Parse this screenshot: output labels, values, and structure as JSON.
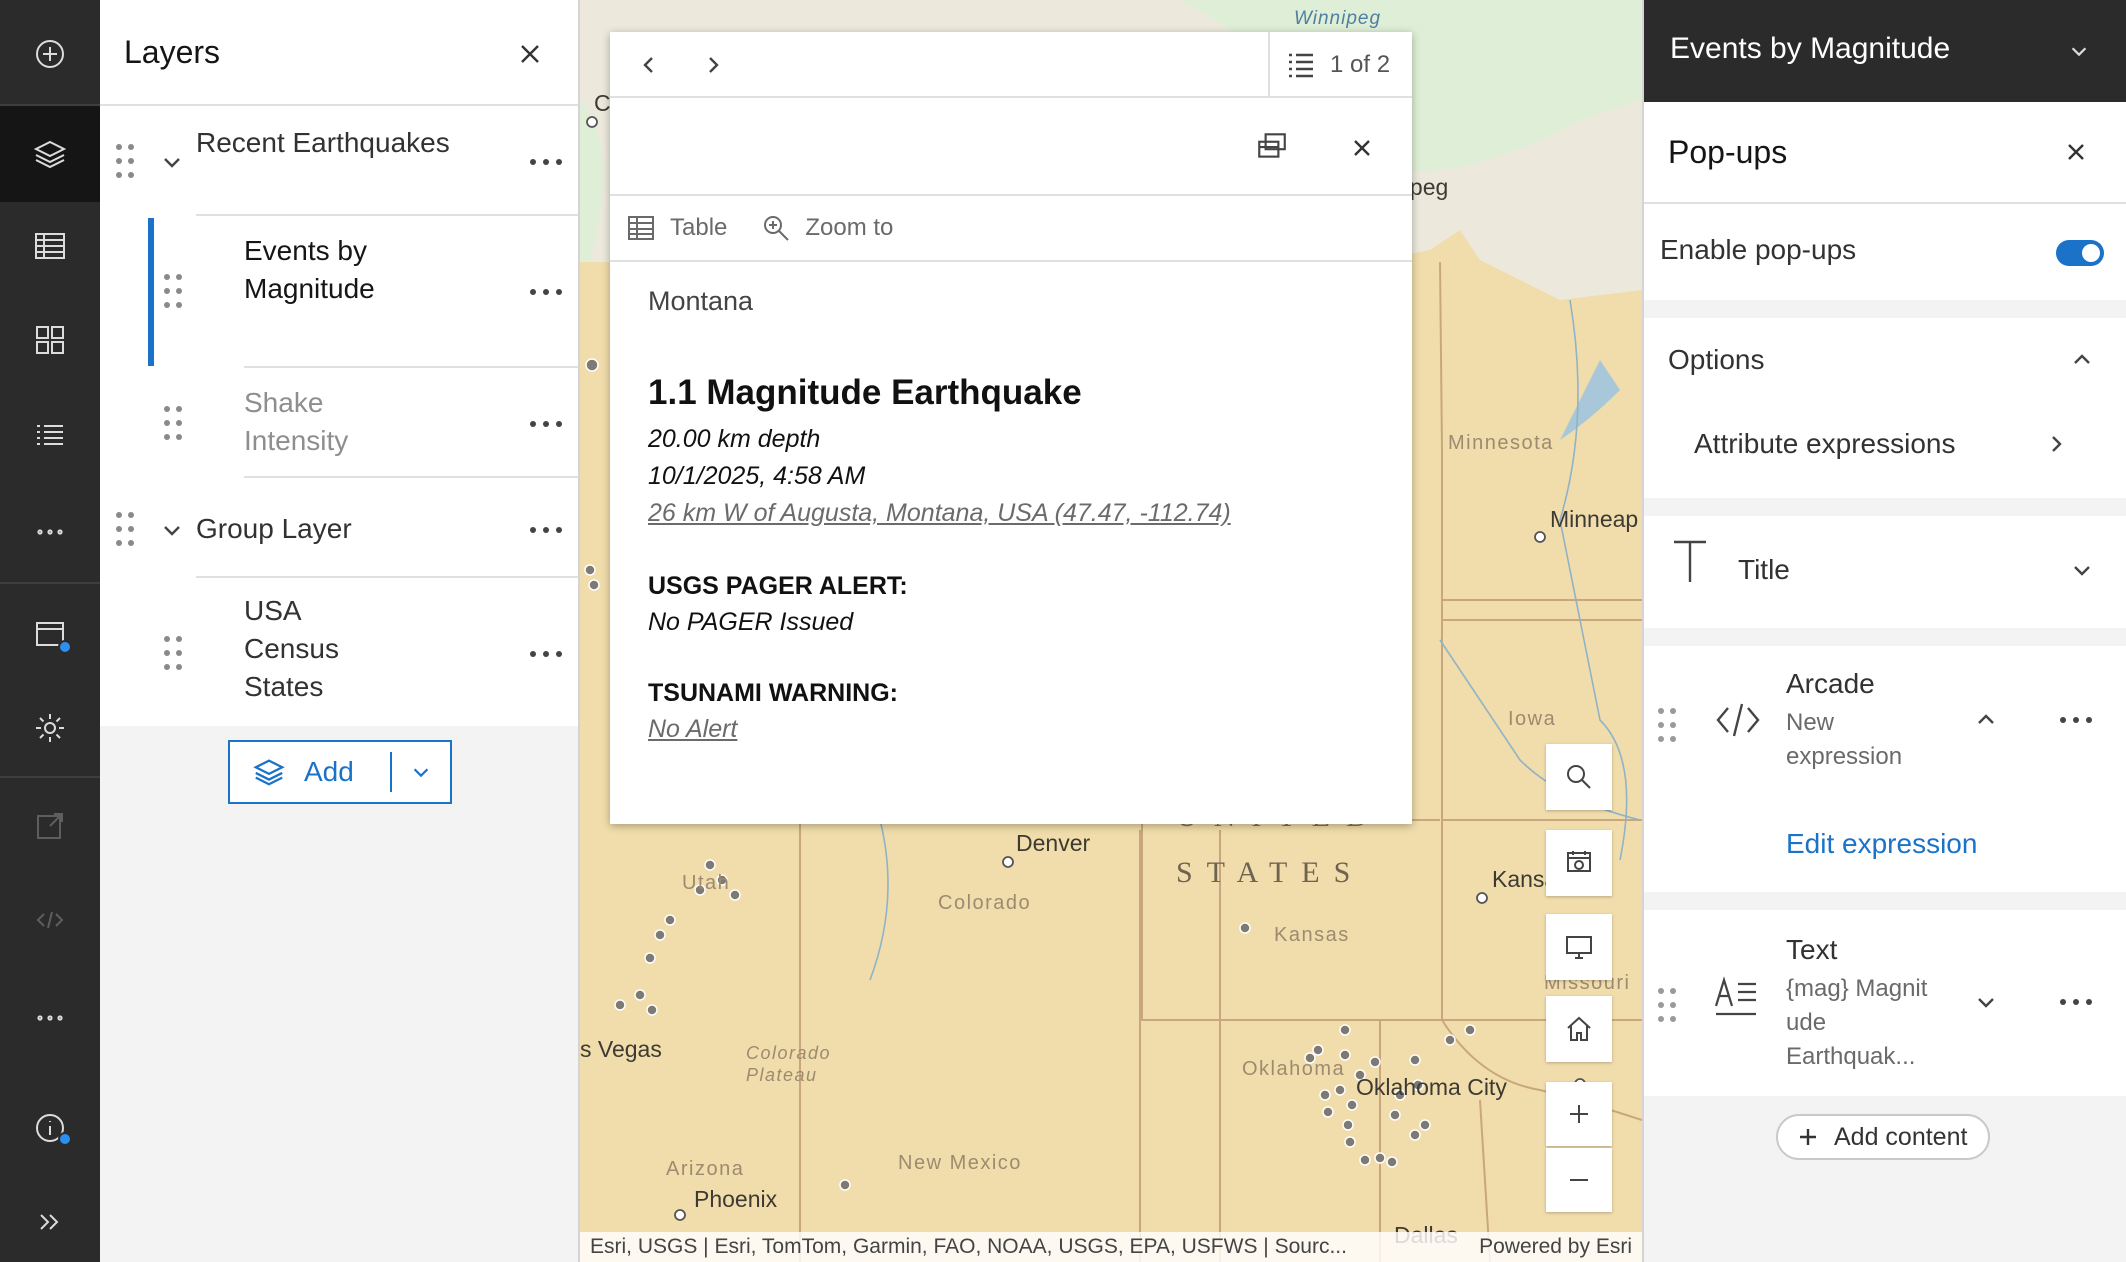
{
  "layers_panel": {
    "title": "Layers",
    "layers": [
      {
        "label": "Recent Earthquakes"
      },
      {
        "label": "Events by Magnitude"
      },
      {
        "label": "Shake Intensity"
      },
      {
        "label": "Group Layer"
      },
      {
        "label": "USA Census States"
      }
    ],
    "add_label": "Add"
  },
  "map": {
    "labels": {
      "winnipeg_top": "Winnipeg",
      "winnipeg": "nipeg",
      "minnesota": "Minnesota",
      "minneapolis": "Minneap",
      "iowa": "Iowa",
      "denver": "Denver",
      "utah": "Utah",
      "colorado": "Colorado",
      "united": "UNITED",
      "states": "STATES",
      "kansas": "Kansas",
      "kansas_city": "Kansa",
      "missouri": "Missouri",
      "vegas": "s Vegas",
      "colorado_plateau": "Colorado Plateau",
      "oklahoma": "Oklahoma",
      "oklahoma_city": "Oklahoma City",
      "arizona": "Arizona",
      "phoenix": "Phoenix",
      "new_mexico": "New Mexico",
      "dallas": "Dallas",
      "edge_c": "C"
    },
    "attribution": "Esri, USGS | Esri, TomTom, Garmin, FAO, NOAA, USGS, EPA, USFWS | Sourc...",
    "powered_by": "Powered by Esri"
  },
  "popup": {
    "count": "1 of 2",
    "tools": {
      "table": "Table",
      "zoom_to": "Zoom to"
    },
    "subtitle": "Montana",
    "title": "1.1 Magnitude Earthquake",
    "depth": "20.00 km depth",
    "datetime": "10/1/2025, 4:58 AM",
    "location_link": "26 km W of Augusta, Montana, USA (47.47, -112.74)",
    "pager_heading": "USGS PAGER ALERT:",
    "pager_value": "No PAGER Issued",
    "tsunami_heading": "TSUNAMI WARNING:",
    "tsunami_value": "No Alert"
  },
  "config_panel": {
    "header": "Events by Magnitude",
    "title": "Pop-ups",
    "enable_label": "Enable pop-ups",
    "enable_on": true,
    "options_label": "Options",
    "attribute_expressions": "Attribute expressions",
    "title_element": "Title",
    "arcade": {
      "title": "Arcade",
      "subtitle_1": "New",
      "subtitle_2": "expression",
      "edit": "Edit expression"
    },
    "text": {
      "title": "Text",
      "line_1": "{mag} Magnit",
      "line_2": "ude",
      "line_3": "Earthquak..."
    },
    "add_content": "Add content"
  },
  "colors": {
    "accent": "#1a73c9",
    "rail": "#2b2b2b",
    "map_land": "#f1ddab"
  }
}
